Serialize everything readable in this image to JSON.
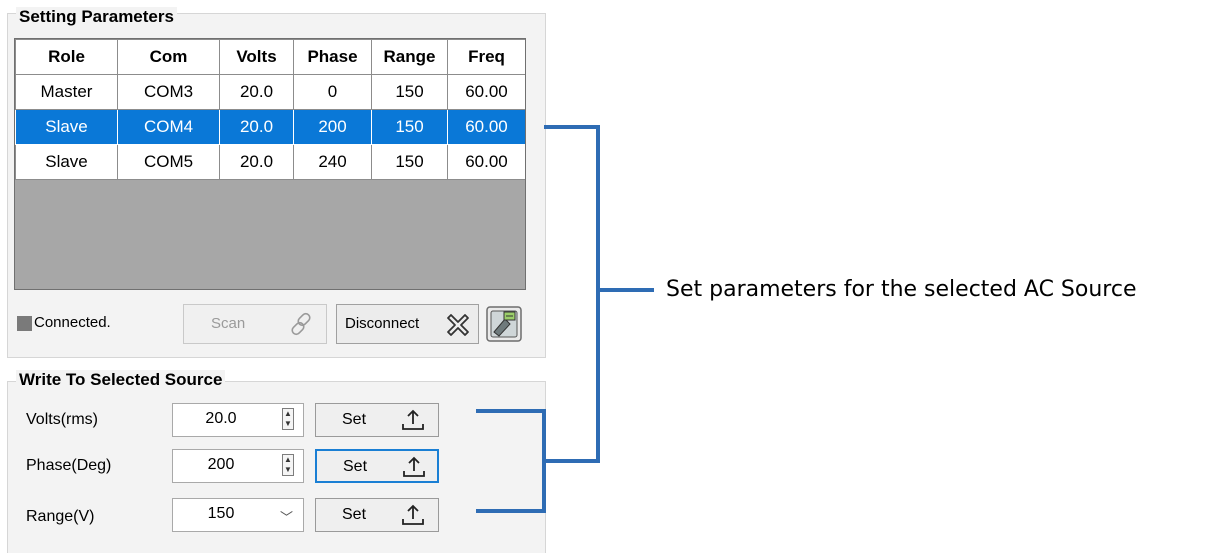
{
  "setting_parameters": {
    "title": "Setting Parameters",
    "columns": [
      "Role",
      "Com",
      "Volts",
      "Phase",
      "Range",
      "Freq"
    ],
    "rows": [
      {
        "role": "Master",
        "com": "COM3",
        "volts": "20.0",
        "phase": "0",
        "range": "150",
        "freq": "60.00"
      },
      {
        "role": "Slave",
        "com": "COM4",
        "volts": "20.0",
        "phase": "200",
        "range": "150",
        "freq": "60.00"
      },
      {
        "role": "Slave",
        "com": "COM5",
        "volts": "20.0",
        "phase": "240",
        "range": "150",
        "freq": "60.00"
      }
    ],
    "selected_row": 1,
    "status_text": "Connected.",
    "scan_label": "Scan",
    "disconnect_label": "Disconnect"
  },
  "write_to_selected": {
    "title": "Write To Selected Source",
    "fields": [
      {
        "label": "Volts(rms)",
        "value": "20.0",
        "set_label": "Set"
      },
      {
        "label": "Phase(Deg)",
        "value": "200",
        "set_label": "Set"
      },
      {
        "label": "Range(V)",
        "value": "150",
        "set_label": "Set"
      }
    ]
  },
  "annotation": {
    "text": "Set parameters for the selected AC Source"
  },
  "colors": {
    "selection": "#0a78d7",
    "bracket": "#2e6cb4",
    "grid_background": "#a7a7a7",
    "status_led": "#7a7a7a"
  },
  "icons": [
    "link-icon",
    "disconnect-x-icon",
    "device-tool-icon",
    "upload-icon",
    "spin-up-icon",
    "spin-down-icon",
    "dropdown-chevron-icon"
  ]
}
